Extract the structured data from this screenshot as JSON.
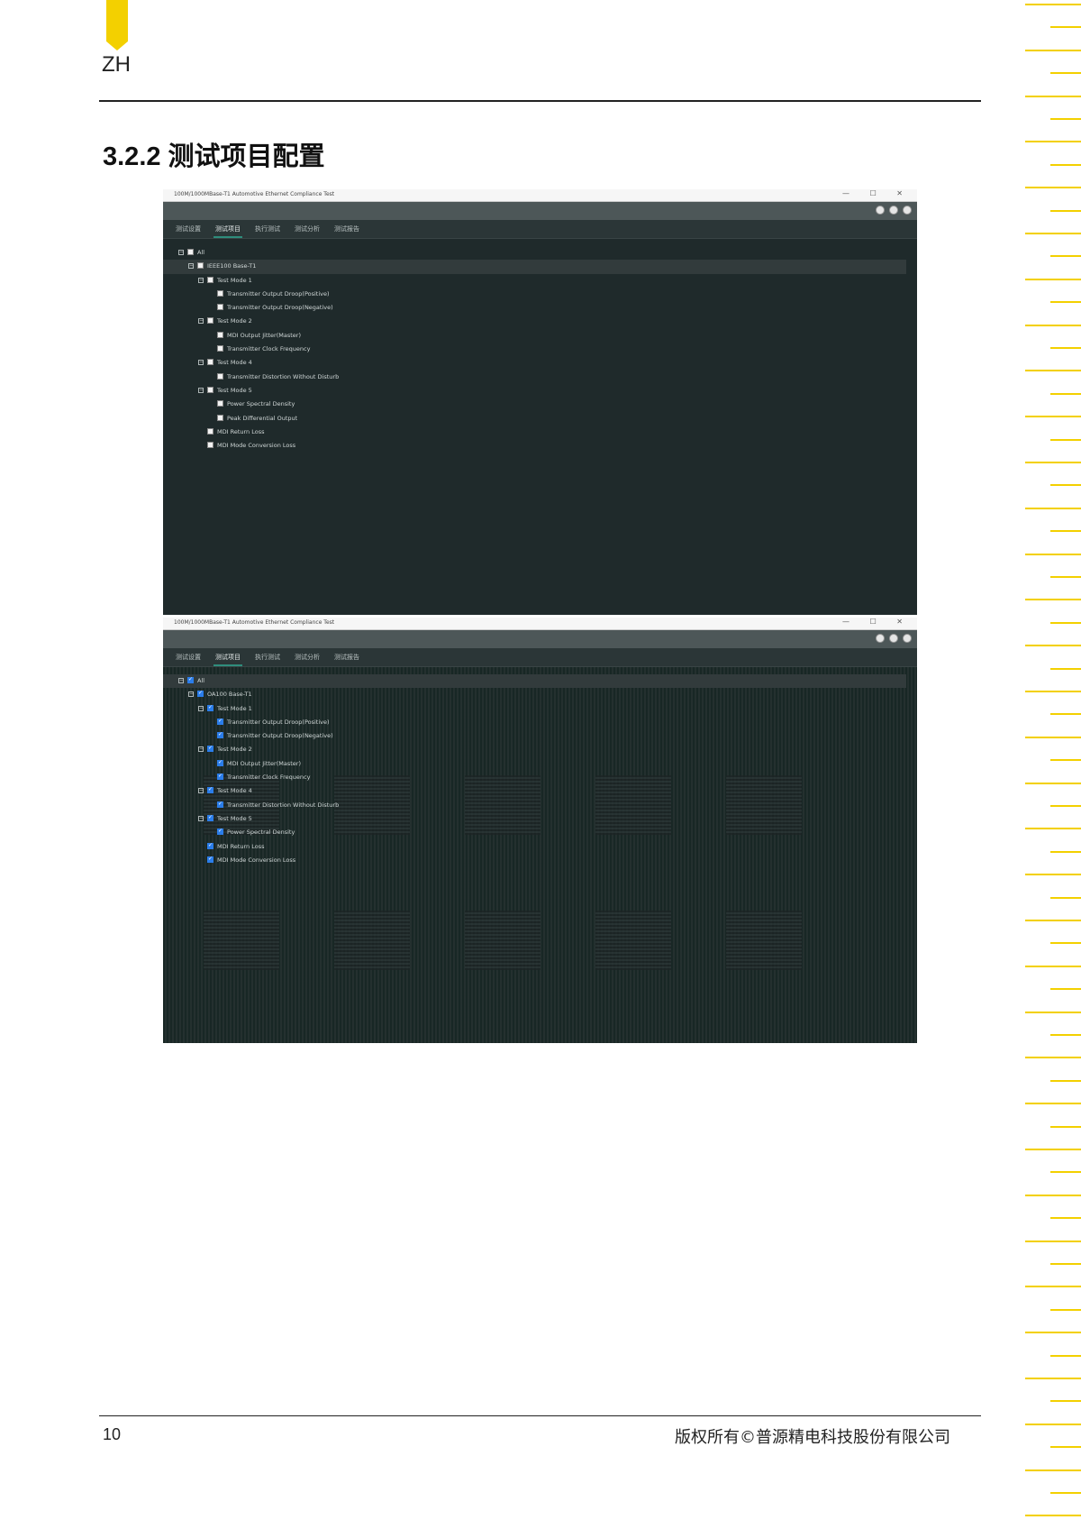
{
  "header": {
    "lang": "ZH"
  },
  "section": {
    "title": "3.2.2   测试项目配置"
  },
  "footer": {
    "page": "10",
    "copyright": "版权所有©普源精电科技股份有限公司"
  },
  "colors": {
    "accent": "#f3d000",
    "app_bg": "#1f2a2b",
    "tab_underline": "#2f8d7c",
    "checkbox_on": "#2b7de9"
  },
  "screenshot1": {
    "window_title": "100M/1000MBase-T1 Automotive Ethernet Compliance Test",
    "window_controls": "— ☐ ✕",
    "tabs": [
      "测试设置",
      "测试项目",
      "执行测试",
      "测试分析",
      "测试报告"
    ],
    "active_tab": 1,
    "tree": [
      {
        "label": "All",
        "checked": false
      },
      {
        "label": "IEEE100 Base-T1",
        "checked": false
      },
      {
        "label": "Test Mode 1",
        "checked": false
      },
      {
        "label": "Transmitter Output Droop(Positive)",
        "checked": false
      },
      {
        "label": "Transmitter Output Droop(Negative)",
        "checked": false
      },
      {
        "label": "Test Mode 2",
        "checked": false
      },
      {
        "label": "MDI Output Jitter(Master)",
        "checked": false
      },
      {
        "label": "Transmitter Clock Frequency",
        "checked": false
      },
      {
        "label": "Test Mode 4",
        "checked": false
      },
      {
        "label": "Transmitter Distortion Without Disturb",
        "checked": false
      },
      {
        "label": "Test Mode 5",
        "checked": false
      },
      {
        "label": "Power Spectral Density",
        "checked": false
      },
      {
        "label": "Peak Differential Output",
        "checked": false
      },
      {
        "label": "MDI Return Loss",
        "checked": false
      },
      {
        "label": "MDI Mode Conversion Loss",
        "checked": false
      }
    ]
  },
  "screenshot2": {
    "window_title": "100M/1000MBase-T1 Automotive Ethernet Compliance Test",
    "window_controls": "— ☐ ✕",
    "tabs": [
      "测试设置",
      "测试项目",
      "执行测试",
      "测试分析",
      "测试报告"
    ],
    "active_tab": 1,
    "tree": [
      {
        "label": "All",
        "checked": true
      },
      {
        "label": "OA100 Base-T1",
        "checked": true
      },
      {
        "label": "Test Mode 1",
        "checked": true
      },
      {
        "label": "Transmitter Output Droop(Positive)",
        "checked": true
      },
      {
        "label": "Transmitter Output Droop(Negative)",
        "checked": true
      },
      {
        "label": "Test Mode 2",
        "checked": true
      },
      {
        "label": "MDI Output Jitter(Master)",
        "checked": true
      },
      {
        "label": "Transmitter Clock Frequency",
        "checked": true
      },
      {
        "label": "Test Mode 4",
        "checked": true
      },
      {
        "label": "Transmitter Distortion Without Disturb",
        "checked": true
      },
      {
        "label": "Test Mode 5",
        "checked": true
      },
      {
        "label": "Power Spectral Density",
        "checked": true
      },
      {
        "label": "MDI Return Loss",
        "checked": true
      },
      {
        "label": "MDI Mode Conversion Loss",
        "checked": true
      }
    ]
  }
}
